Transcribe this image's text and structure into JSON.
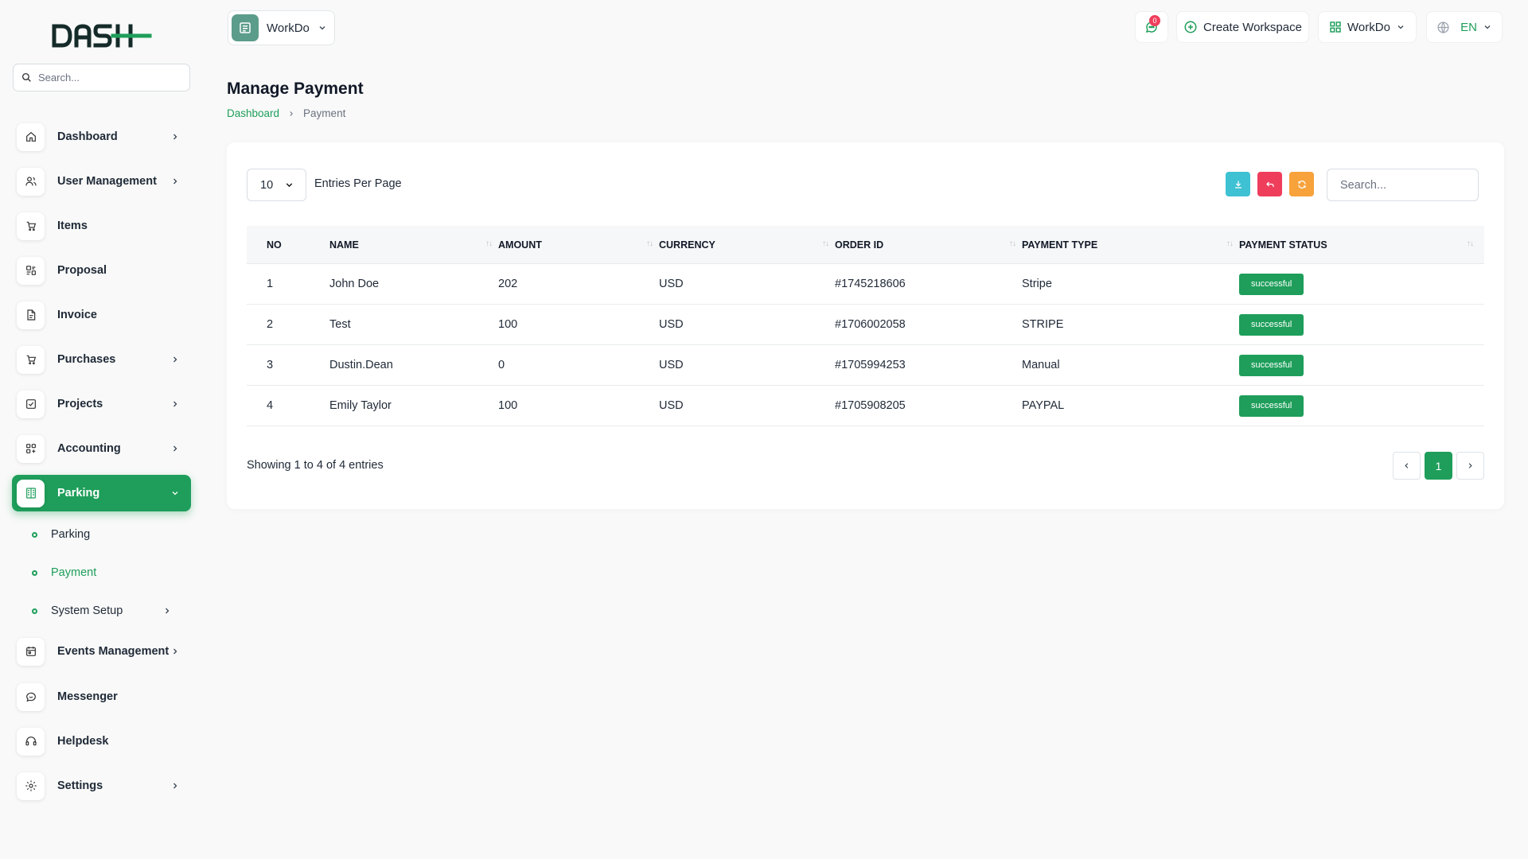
{
  "sidebar": {
    "search_placeholder": "Search...",
    "items": [
      {
        "label": "Dashboard",
        "icon": "home-icon",
        "chevron": true
      },
      {
        "label": "User Management",
        "icon": "users-icon",
        "chevron": true
      },
      {
        "label": "Items",
        "icon": "cart-icon",
        "chevron": false
      },
      {
        "label": "Proposal",
        "icon": "proposal-icon",
        "chevron": false
      },
      {
        "label": "Invoice",
        "icon": "file-icon",
        "chevron": false
      },
      {
        "label": "Purchases",
        "icon": "cart-icon",
        "chevron": true
      },
      {
        "label": "Projects",
        "icon": "check-square-icon",
        "chevron": true
      },
      {
        "label": "Accounting",
        "icon": "grid-icon",
        "chevron": true
      },
      {
        "label": "Parking",
        "icon": "parking-icon",
        "chevron": true,
        "active": true
      },
      {
        "label": "Events Management",
        "icon": "calendar-icon",
        "chevron": true
      },
      {
        "label": "Messenger",
        "icon": "message-icon",
        "chevron": false
      },
      {
        "label": "Helpdesk",
        "icon": "headset-icon",
        "chevron": false
      },
      {
        "label": "Settings",
        "icon": "gear-icon",
        "chevron": true
      }
    ],
    "sub_items": [
      {
        "label": "Parking",
        "active": false,
        "chevron": false
      },
      {
        "label": "Payment",
        "active": true,
        "chevron": false
      },
      {
        "label": "System Setup",
        "active": false,
        "chevron": true
      }
    ]
  },
  "header": {
    "workspace": "WorkDo",
    "notification_count": "0",
    "create_workspace": "Create Workspace",
    "workspace_menu": "WorkDo",
    "language": "EN"
  },
  "page": {
    "title": "Manage Payment",
    "breadcrumb": [
      "Dashboard",
      "Payment"
    ]
  },
  "table": {
    "per_page_value": "10",
    "per_page_label": "Entries Per Page",
    "search_placeholder": "Search...",
    "columns": [
      "NO",
      "NAME",
      "AMOUNT",
      "CURRENCY",
      "ORDER ID",
      "PAYMENT TYPE",
      "PAYMENT STATUS"
    ],
    "rows": [
      [
        "1",
        "John Doe",
        "202",
        "USD",
        "#1745218606",
        "Stripe",
        "successful"
      ],
      [
        "2",
        "Test",
        "100",
        "USD",
        "#1706002058",
        "STRIPE",
        "successful"
      ],
      [
        "3",
        "Dustin.Dean",
        "0",
        "USD",
        "#1705994253",
        "Manual",
        "successful"
      ],
      [
        "4",
        "Emily Taylor",
        "100",
        "USD",
        "#1705908205",
        "PAYPAL",
        "successful"
      ]
    ],
    "showing": "Showing 1 to 4 of 4 entries",
    "current_page": "1"
  },
  "colors": {
    "accent": "#1e9e5a",
    "download": "#3ec1d3",
    "reset": "#ef3e5c",
    "refresh": "#f7a23b"
  }
}
